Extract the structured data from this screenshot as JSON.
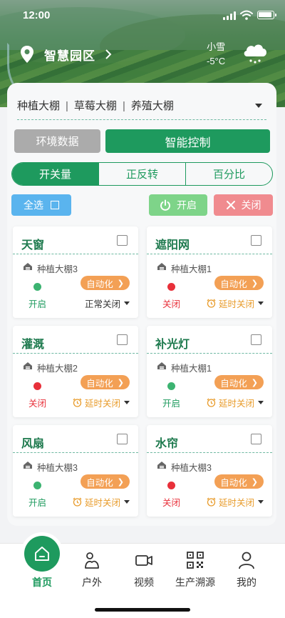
{
  "status_bar": {
    "time": "12:00"
  },
  "header": {
    "location_name": "智慧园区",
    "weather": {
      "condition": "小雪",
      "temperature": "-5°C",
      "icon": "snow-cloud-icon"
    }
  },
  "greenhouse_selector": {
    "items": [
      "种植大棚",
      "草莓大棚",
      "养殖大棚"
    ],
    "separator": "|"
  },
  "main_tabs": {
    "env_label": "环境数据",
    "control_label": "智能控制",
    "active": "智能控制"
  },
  "segments": [
    {
      "label": "开关量",
      "active": true
    },
    {
      "label": "正反转",
      "active": false
    },
    {
      "label": "百分比",
      "active": false
    }
  ],
  "actions": {
    "select_all": "全选",
    "on": "开启",
    "off": "关闭"
  },
  "devices": [
    {
      "name": "天窗",
      "location": "种植大棚3",
      "auto_label": "自动化",
      "state": "开启",
      "mode": "正常关闭"
    },
    {
      "name": "遮阳网",
      "location": "种植大棚1",
      "auto_label": "自动化",
      "state": "关闭",
      "mode": "延时关闭"
    },
    {
      "name": "灌溉",
      "location": "种植大棚2",
      "auto_label": "自动化",
      "state": "关闭",
      "mode": "延时关闭"
    },
    {
      "name": "补光灯",
      "location": "种植大棚1",
      "auto_label": "自动化",
      "state": "开启",
      "mode": "延时关闭"
    },
    {
      "name": "风扇",
      "location": "种植大棚3",
      "auto_label": "自动化",
      "state": "开启",
      "mode": "延时关闭"
    },
    {
      "name": "水帘",
      "location": "种植大棚3",
      "auto_label": "自动化",
      "state": "关闭",
      "mode": "延时关闭"
    }
  ],
  "colors": {
    "primary": "#1e9a5e",
    "on": "#3cb371",
    "off": "#e8303a",
    "auto": "#f3a055",
    "select_all": "#5ab4ee"
  },
  "tabbar": [
    {
      "label": "首页",
      "icon": "home-icon",
      "active": true
    },
    {
      "label": "户外",
      "icon": "outdoor-icon",
      "active": false
    },
    {
      "label": "视频",
      "icon": "video-camera-icon",
      "active": false
    },
    {
      "label": "生产溯源",
      "icon": "qr-code-icon",
      "active": false
    },
    {
      "label": "我的",
      "icon": "user-icon",
      "active": false
    }
  ]
}
